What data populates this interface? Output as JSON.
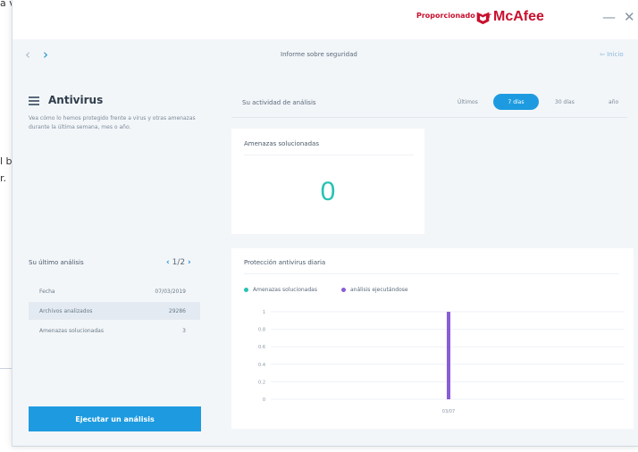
{
  "background": {
    "frag1": "a v",
    "frag2": "l b",
    "frag3": "r."
  },
  "titlebar": {
    "powered_by": "Proporcionado por",
    "brand": "McAfee",
    "minimize": "—",
    "close": "✕",
    "brand_color": "#c8102e"
  },
  "nav": {
    "back_icon": "‹",
    "forward_icon": "›",
    "title": "Informe sobre seguridad",
    "home": "⇦ Inicio"
  },
  "antivirus": {
    "title": "Antivirus",
    "description": "Vea cómo lo hemos protegido frente a virus y otras amenazas durante la última semana, mes o año."
  },
  "last_scan": {
    "label": "Su último análisis",
    "pager": "1/2",
    "rows": [
      {
        "key": "Fecha",
        "value": "07/03/2019"
      },
      {
        "key": "Archivos analizados",
        "value": "29286"
      },
      {
        "key": "Amenazas solucionadas",
        "value": "3"
      }
    ]
  },
  "run_button": "Ejecutar un análisis",
  "activity": {
    "label": "Su actividad de análisis",
    "last": "Últimos",
    "seg_7": "7 días",
    "seg_30": "30 días",
    "seg_year": "año"
  },
  "threats": {
    "title": "Amenazas solucionadas",
    "count": "0"
  },
  "daily": {
    "title": "Protección antivirus diaria",
    "legend": [
      {
        "name": "Amenazas solucionadas",
        "color": "#27c2b3"
      },
      {
        "name": "análisis ejecutándose",
        "color": "#8a5cd6"
      }
    ]
  },
  "chart_data": {
    "type": "bar",
    "categories": [
      "03/07"
    ],
    "series": [
      {
        "name": "Amenazas solucionadas",
        "values": [
          0
        ]
      },
      {
        "name": "análisis ejecutándose",
        "values": [
          1
        ]
      }
    ],
    "yticks": [
      "1",
      "0.8",
      "0.6",
      "0.4",
      "0.2",
      "0"
    ],
    "ylim": [
      0,
      1
    ],
    "grid": true,
    "legend": "top-left"
  },
  "accent": "#1e9be0"
}
